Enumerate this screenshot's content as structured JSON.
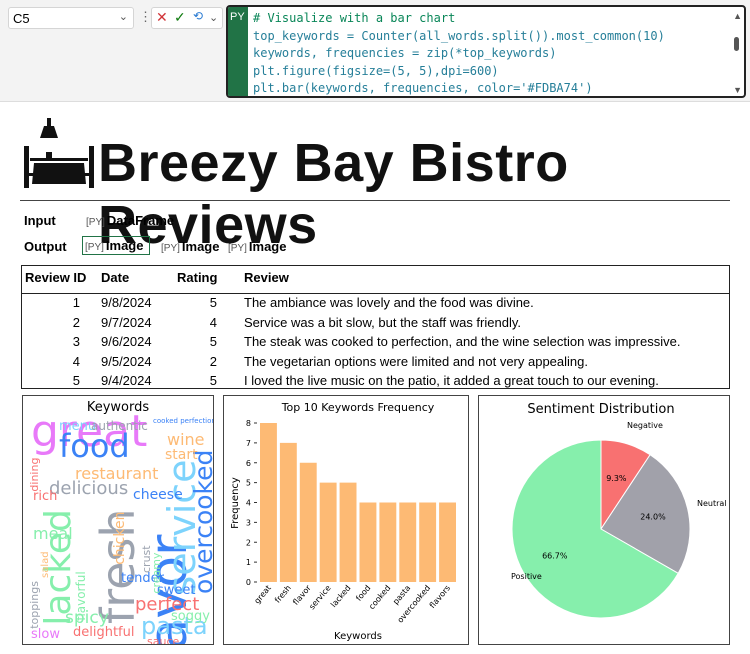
{
  "toolbar": {
    "name_box": "C5",
    "cancel_icon": "x-icon",
    "enter_icon": "check-icon",
    "py_label": "PY"
  },
  "editor": {
    "lines": [
      "# Visualize with a bar chart",
      "top_keywords = Counter(all_words.split()).most_common(10)",
      "keywords, frequencies = zip(*top_keywords)",
      "plt.figure(figsize=(5, 5),dpi=600)",
      "plt.bar(keywords, frequencies, color='#FDBA74')"
    ]
  },
  "sheet": {
    "title": "Breezy Bay Bistro Reviews",
    "input_label": "Input",
    "input_value": "DataFrame",
    "output_label": "Output",
    "outputs": [
      "Image",
      "Image",
      "Image"
    ],
    "py_tag": "[PY]"
  },
  "table": {
    "headers": [
      "Review ID",
      "Date",
      "Rating",
      "Review"
    ],
    "rows": [
      [
        "1",
        "9/8/2024",
        "5",
        "The ambiance was lovely and the food was divine."
      ],
      [
        "2",
        "9/7/2024",
        "4",
        "Service was a bit slow, but the staff was friendly."
      ],
      [
        "3",
        "9/6/2024",
        "5",
        "The steak was cooked to perfection, and the wine selection was impressive."
      ],
      [
        "4",
        "9/5/2024",
        "2",
        "The vegetarian options were limited and not very appealing."
      ],
      [
        "5",
        "9/4/2024",
        "5",
        "I loved the live music on the patio, it added a great touch to our evening."
      ]
    ]
  },
  "chart_data": [
    {
      "type": "wordcloud",
      "title": "Keywords",
      "words": [
        "great",
        "flavor",
        "fresh",
        "service",
        "lacked",
        "food",
        "overcooked",
        "pasta",
        "delicious",
        "restaurant",
        "perfect",
        "chicken",
        "spicy",
        "cheese",
        "meal",
        "sweet",
        "tender",
        "wine",
        "start",
        "menu",
        "authentic",
        "delightful",
        "slow",
        "sauce",
        "soggy",
        "toppings",
        "creamy",
        "flavorful",
        "rich",
        "dining",
        "crust",
        "salad",
        "cooked perfection"
      ]
    },
    {
      "type": "bar",
      "title": "Top 10 Keywords Frequency",
      "xlabel": "Keywords",
      "ylabel": "Frequency",
      "categories": [
        "great",
        "fresh",
        "flavor",
        "service",
        "lacked",
        "food",
        "cooked",
        "pasta",
        "overcooked",
        "flavors"
      ],
      "values": [
        8,
        7,
        6,
        5,
        5,
        4,
        4,
        4,
        4,
        4
      ],
      "ylim": [
        0,
        8
      ],
      "yticks": [
        0,
        1,
        2,
        3,
        4,
        5,
        6,
        7,
        8
      ],
      "color": "#FDBA74"
    },
    {
      "type": "pie",
      "title": "Sentiment Distribution",
      "labels": [
        "Negative",
        "Neutral",
        "Positive"
      ],
      "values": [
        9.3,
        24.0,
        66.7
      ],
      "pct_labels": [
        "9.3%",
        "24.0%",
        "66.7%"
      ],
      "colors": [
        "#F87171",
        "#A1A1AA",
        "#86EFAC"
      ]
    }
  ]
}
